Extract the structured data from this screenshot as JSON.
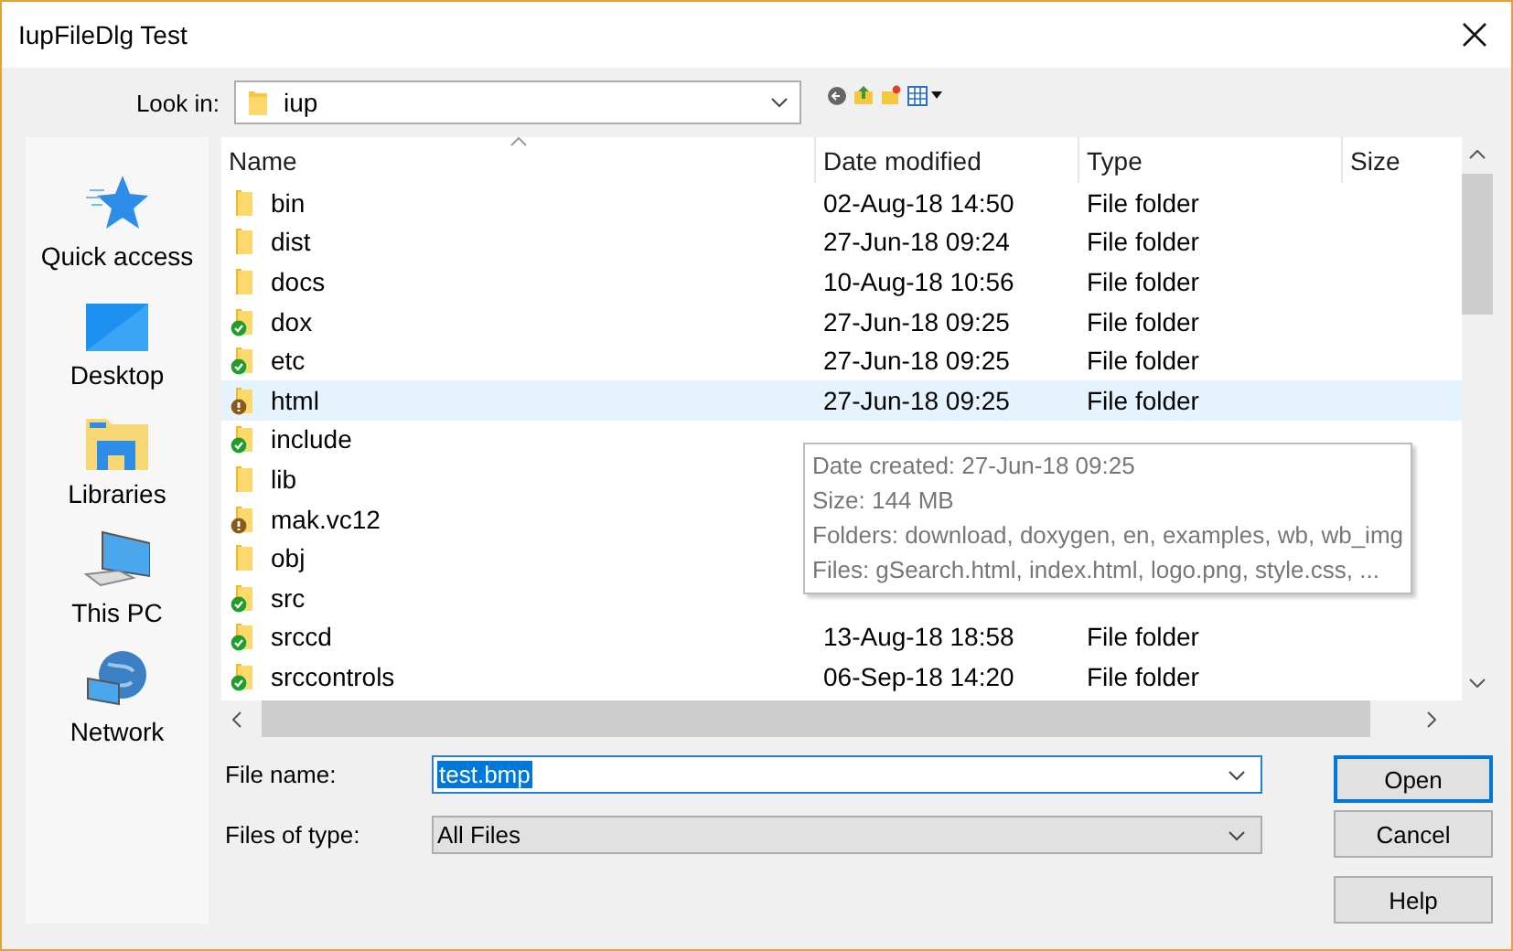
{
  "window": {
    "title": "IupFileDlg Test"
  },
  "look_in": {
    "label": "Look in:",
    "value": "iup"
  },
  "places": [
    {
      "kind": "star",
      "label": "Quick access"
    },
    {
      "kind": "desktop",
      "label": "Desktop"
    },
    {
      "kind": "libraries",
      "label": "Libraries"
    },
    {
      "kind": "pc",
      "label": "This PC"
    },
    {
      "kind": "network",
      "label": "Network"
    }
  ],
  "columns": [
    "Name",
    "Date modified",
    "Type",
    "Size"
  ],
  "rows": [
    {
      "name": "bin",
      "kind": "plain",
      "date": "02-Aug-18 14:50",
      "type": "File folder",
      "selected": false
    },
    {
      "name": "dist",
      "kind": "plain",
      "date": "27-Jun-18 09:24",
      "type": "File folder",
      "selected": false
    },
    {
      "name": "docs",
      "kind": "plain",
      "date": "10-Aug-18 10:56",
      "type": "File folder",
      "selected": false
    },
    {
      "name": "dox",
      "kind": "synced",
      "date": "27-Jun-18 09:25",
      "type": "File folder",
      "selected": false
    },
    {
      "name": "etc",
      "kind": "synced",
      "date": "27-Jun-18 09:25",
      "type": "File folder",
      "selected": false
    },
    {
      "name": "html",
      "kind": "warning",
      "date": "27-Jun-18 09:25",
      "type": "File folder",
      "selected": true
    },
    {
      "name": "include",
      "kind": "synced",
      "selected": false
    },
    {
      "name": "lib",
      "kind": "plain",
      "selected": false
    },
    {
      "name": "mak.vc12",
      "kind": "warning",
      "selected": false
    },
    {
      "name": "obj",
      "kind": "plain",
      "selected": false
    },
    {
      "name": "src",
      "kind": "synced",
      "selected": false
    },
    {
      "name": "srccd",
      "kind": "synced",
      "date": "13-Aug-18 18:58",
      "type": "File folder",
      "selected": false
    },
    {
      "name": "srccontrols",
      "kind": "synced",
      "date": "06-Sep-18 14:20",
      "type": "File folder",
      "selected": false
    }
  ],
  "tooltip": [
    "Date created: 27-Jun-18 09:25",
    "Size: 144 MB",
    "Folders: download, doxygen, en, examples, wb, wb_img",
    "Files: gSearch.html, index.html, logo.png, style.css, ..."
  ],
  "file_name": {
    "label": "File name:",
    "value": "test.bmp"
  },
  "file_type": {
    "label": "Files of type:",
    "value": "All Files"
  },
  "buttons": [
    "Open",
    "Cancel",
    "Help"
  ]
}
